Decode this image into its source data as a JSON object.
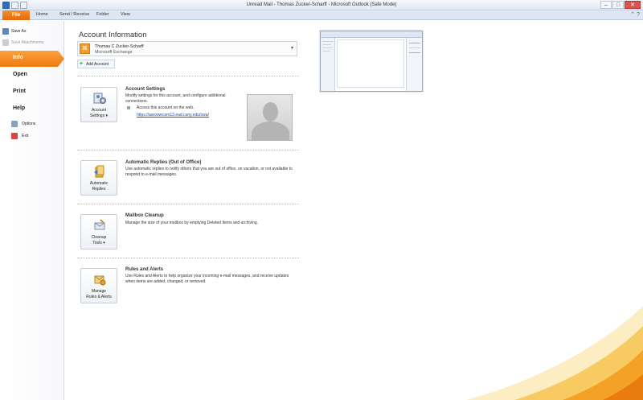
{
  "window": {
    "title": "Unread Mail - Thomas Zucker-Scharff - Microsoft Outlook (Safe Mode)",
    "controls": {
      "minimize": "–",
      "maximize": "□",
      "close": "✕"
    }
  },
  "ribbon": {
    "tabs": [
      "File",
      "Home",
      "Send / Receive",
      "Folder",
      "View"
    ]
  },
  "leftnav": {
    "save_as": "Save As",
    "save_attachments": "Save Attachments",
    "info": "Info",
    "open": "Open",
    "print": "Print",
    "help": "Help",
    "options": "Options",
    "exit": "Exit"
  },
  "main": {
    "heading": "Account Information",
    "account": {
      "name": "Thomas C Zucker-Scharff",
      "type": "Microsoft Exchange"
    },
    "add_account": "Add Account",
    "sections": {
      "account_settings": {
        "button": "Account\nSettings ▾",
        "title": "Account Settings",
        "desc": "Modify settings for this account, and configure additional connections.",
        "item": "Access this account on the web.",
        "link": "https://asexwecom13.ead.cuny.edu/owa/"
      },
      "auto_replies": {
        "button": "Automatic\nReplies",
        "title": "Automatic Replies (Out of Office)",
        "desc": "Use automatic replies to notify others that you are out of office, on vacation, or not available to respond to e-mail messages."
      },
      "cleanup": {
        "button": "Cleanup\nTools ▾",
        "title": "Mailbox Cleanup",
        "desc": "Manage the size of your mailbox by emptying Deleted Items and archiving."
      },
      "rules": {
        "button": "Manage\nRules & Alerts",
        "title": "Rules and Alerts",
        "desc": "Use Rules and Alerts to help organize your incoming e-mail messages, and receive updates when items are added, changed, or removed."
      }
    }
  },
  "colors": {
    "file_tab": "#e8760f",
    "accent": "#f07a12",
    "link": "#1f4fa8"
  }
}
